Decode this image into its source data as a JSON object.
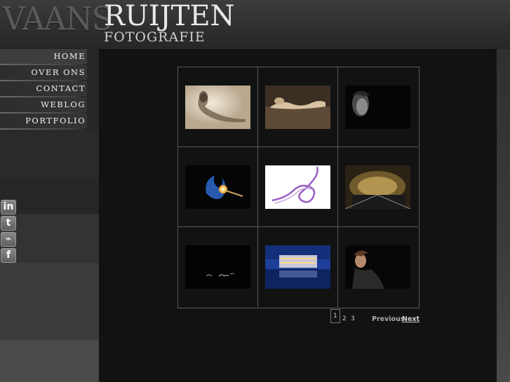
{
  "logo": {
    "left_word": "VAANS",
    "right_word": "RUIJTEN",
    "subtitle": "FOTOGRAFIE"
  },
  "nav": {
    "items": [
      {
        "label": "HOME"
      },
      {
        "label": "OVER ONS"
      },
      {
        "label": "CONTACT"
      },
      {
        "label": "WEBLOG"
      },
      {
        "label": "PORTFOLIO"
      }
    ]
  },
  "social": [
    {
      "glyph": "in",
      "icon": "linkedin-icon"
    },
    {
      "glyph": "t",
      "icon": "twitter-icon"
    },
    {
      "glyph": "⌁",
      "icon": "rss-icon"
    },
    {
      "glyph": "f",
      "icon": "facebook-icon"
    }
  ],
  "gallery": {
    "thumbnails": [
      {
        "subject": "sepia reclining woman"
      },
      {
        "subject": "sepia woman lying on water"
      },
      {
        "subject": "curly-haired man portrait"
      },
      {
        "subject": "burning match"
      },
      {
        "subject": "purple smoke swirl"
      },
      {
        "subject": "metro tunnel"
      },
      {
        "subject": "dark abstract lights"
      },
      {
        "subject": "night city waterfront"
      },
      {
        "subject": "woman portrait dark"
      }
    ]
  },
  "pagination": {
    "pages": [
      "1",
      "2",
      "3"
    ],
    "current": "1",
    "previous": "Previous",
    "next": "Next"
  },
  "colors": {
    "content_bg": "#121212",
    "grid_line": "#5a5a5a",
    "nav_text": "#f2f2f2"
  }
}
